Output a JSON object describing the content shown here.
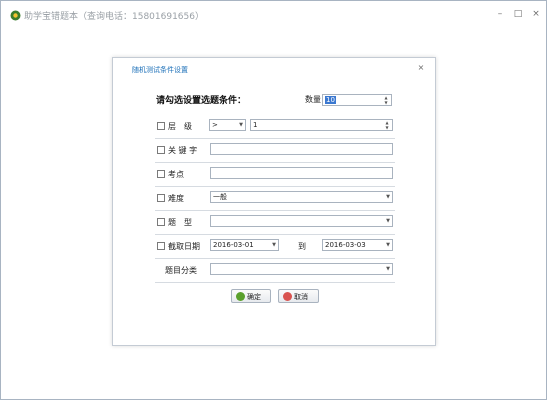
{
  "window": {
    "title": "助学宝错题本（查询电话：15801691656）",
    "minimize": "–",
    "maximize": "□",
    "close": "×"
  },
  "dialog": {
    "title": "随机测试条件设置",
    "close": "×",
    "heading": "请勾选设置选题条件：",
    "quantity": {
      "label": "数量",
      "value": "10"
    },
    "rows": {
      "level": {
        "label": "层　级",
        "operator": ">",
        "value": "1"
      },
      "keyword": {
        "label": "关 键 字",
        "value": ""
      },
      "exam_point": {
        "label": "考点",
        "value": ""
      },
      "difficulty": {
        "label": "难度",
        "value": "一般"
      },
      "question_type": {
        "label": "题　型",
        "value": ""
      },
      "date": {
        "label": "截取日期",
        "from": "2016-03-01",
        "to_label": "到",
        "to": "2016-03-03"
      },
      "category": {
        "label": "题目分类",
        "value": ""
      }
    },
    "ok_button": "确定",
    "cancel_button": "取消"
  },
  "colors": {
    "dialog_title": "#1b6fb8",
    "selection": "#3b78d0",
    "ok_icon": "#5aa02c",
    "cancel_icon": "#d9534f"
  },
  "icons": {
    "app": "app-logo-icon",
    "ok": "check-circle-icon",
    "cancel": "cancel-circle-icon"
  }
}
